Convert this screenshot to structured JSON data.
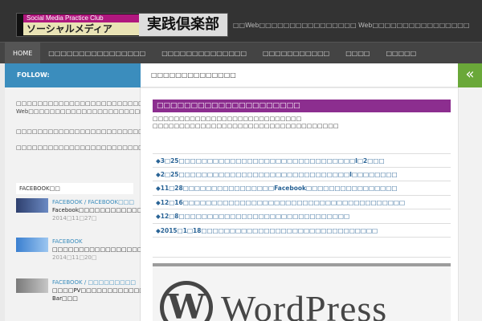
{
  "header": {
    "logo_top": "Social Media Practice Club",
    "logo_bottom": "ソーシャルメディア",
    "logo_right": "実践倶楽部",
    "tagline": "□□Web□□□□□□□□□□□□□□□□ Web□□□□□□□□□□□□□□□□"
  },
  "nav": {
    "items": [
      {
        "label": "HOME"
      },
      {
        "label": "□□□□□□□□□□□□□□□□"
      },
      {
        "label": "□□□□□□□□□□□□□□"
      },
      {
        "label": "□□□□□□□□□□□"
      },
      {
        "label": "□□□□"
      },
      {
        "label": "□□□□□"
      }
    ]
  },
  "follow": {
    "label": "FOLLOW:"
  },
  "content_header": {
    "title": "□□□□□□□□□□□□□□"
  },
  "sidebar": {
    "text1": "□□□□□□□□□□□□□□□□□□□□□□□□□□□□□□□□□□□□□□Web□□□□□□□□□□□□ Web□□□□□□□□□□□□□□□□□□□□□□□",
    "text2": "□□□□□□□□□□□□□□□□□□□□□□□□□□□□□□□□□□□□□□□□□□□",
    "text3": "□□□□□□□□□□□□□□□□□□□□□□□□□□□□□□□□□□□□□□□□□□□□□",
    "fb_heading": "FACEBOOK□□",
    "fb_items": [
      {
        "category": "FACEBOOK / FACEBOOK□□□",
        "title": "Facebook□□□□□□□□□□□□□□□□□□□□□□□□",
        "date": "2014□11□27□"
      },
      {
        "category": "FACEBOOK",
        "title": "□□□□□□□□□□□□□□□□□□□□□□□",
        "date": "2014□11□20□"
      },
      {
        "category": "FACEBOOK / □□□□□□□□□",
        "title": "□□□□PV□□□□□□□□□□□□□facebook□□□□Recommendation Bar□□□",
        "date": ""
      }
    ]
  },
  "main": {
    "post_title": "□□□□□□□□□□□□□□□□□□□□□",
    "intro1": "□□□□□□□□□□□□□□□□□□□□□□□□□□□□",
    "intro2": "□□□□□□□□□□□□□□□□□□□□□□□□□□□□□□□□□□□",
    "links": [
      "◆3□25□□□□□□□□□□□□□□□□□□□□□□□□□□□□□□□I□2□□□",
      "◆2□25□□□□□□□□□□□□□□□□□□□□□□□□□□□□□□I□□□□□□□□",
      "◆11□28□□□□□□□□□□□□□□□□Facebook□□□□□□□□□□□□□□□□",
      "◆12□16□□□□□□□□□□□□□□□□□□□□□□□□□□□□□□□□□□□□□□□",
      "◆12□8□□□□□□□□□□□□□□□□□□□□□□□□□□□□□□",
      "◆2015□1□18□□□□□□□□□□□□□□□□□□□□□□□□□□□□□□□"
    ],
    "banner_text": "WordPress",
    "banner_logo": "W"
  },
  "colors": {
    "header_bg": "#333333",
    "nav_bg": "#444444",
    "follow_bg": "#3b8dbd",
    "toggle_bg": "#6aa839",
    "post_title_bg": "#8c2e8f",
    "link": "#2a6496"
  },
  "icons": {
    "toggle": "double-chevron-left-icon"
  }
}
